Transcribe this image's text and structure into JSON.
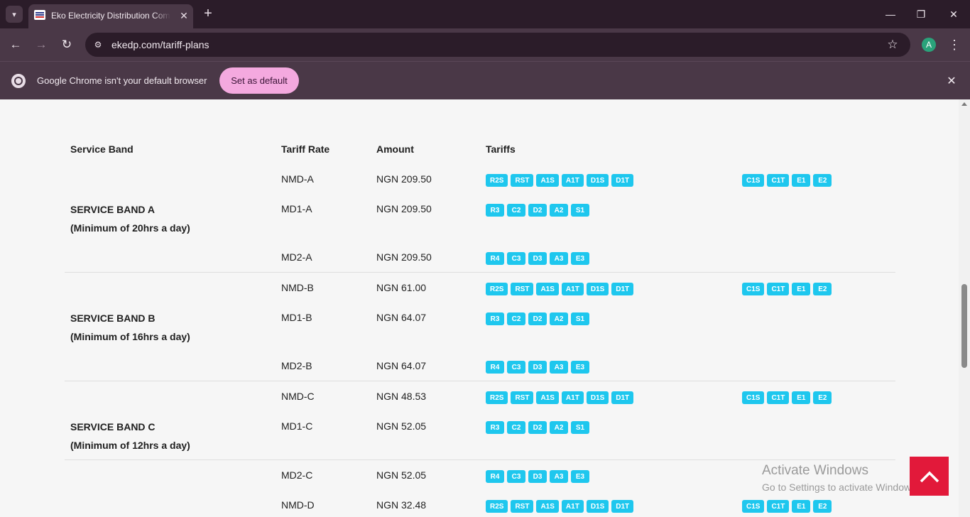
{
  "browser": {
    "tab_title": "Eko Electricity Distribution Company",
    "url": "ekedp.com/tariff-plans",
    "avatar_letter": "A",
    "infobar_text": "Google Chrome isn't your default browser",
    "set_default_label": "Set as default"
  },
  "table": {
    "headers": {
      "service_band": "Service Band",
      "tariff_rate": "Tariff Rate",
      "amount": "Amount",
      "tariffs": "Tariffs"
    },
    "bands": [
      {
        "name": "SERVICE BAND A",
        "subtitle": "(Minimum of 20hrs a day)",
        "rows": [
          {
            "rate": "NMD-A",
            "amount": "NGN 209.50",
            "tariffs": [
              "R2S",
              "RST",
              "A1S",
              "A1T",
              "D1S",
              "D1T"
            ],
            "tariffs_extra": [
              "C1S",
              "C1T",
              "E1",
              "E2"
            ]
          },
          {
            "rate": "MD1-A",
            "amount": "NGN 209.50",
            "tariffs": [
              "R3",
              "C2",
              "D2",
              "A2",
              "S1"
            ],
            "tariffs_extra": []
          },
          {
            "rate": "MD2-A",
            "amount": "NGN 209.50",
            "tariffs": [
              "R4",
              "C3",
              "D3",
              "A3",
              "E3"
            ],
            "tariffs_extra": []
          }
        ]
      },
      {
        "name": "SERVICE BAND B",
        "subtitle": "(Minimum of 16hrs a day)",
        "rows": [
          {
            "rate": "NMD-B",
            "amount": "NGN 61.00",
            "tariffs": [
              "R2S",
              "RST",
              "A1S",
              "A1T",
              "D1S",
              "D1T"
            ],
            "tariffs_extra": [
              "C1S",
              "C1T",
              "E1",
              "E2"
            ]
          },
          {
            "rate": "MD1-B",
            "amount": "NGN 64.07",
            "tariffs": [
              "R3",
              "C2",
              "D2",
              "A2",
              "S1"
            ],
            "tariffs_extra": []
          },
          {
            "rate": "MD2-B",
            "amount": "NGN 64.07",
            "tariffs": [
              "R4",
              "C3",
              "D3",
              "A3",
              "E3"
            ],
            "tariffs_extra": []
          }
        ]
      },
      {
        "name": "SERVICE BAND C",
        "subtitle": "(Minimum of 12hrs a day)",
        "rows": [
          {
            "rate": "NMD-C",
            "amount": "NGN 48.53",
            "tariffs": [
              "R2S",
              "RST",
              "A1S",
              "A1T",
              "D1S",
              "D1T"
            ],
            "tariffs_extra": [
              "C1S",
              "C1T",
              "E1",
              "E2"
            ]
          },
          {
            "rate": "MD1-C",
            "amount": "NGN 52.05",
            "tariffs": [
              "R3",
              "C2",
              "D2",
              "A2",
              "S1"
            ],
            "tariffs_extra": []
          },
          {
            "rate": "MD2-C",
            "amount": "NGN 52.05",
            "tariffs": [
              "R4",
              "C3",
              "D3",
              "A3",
              "E3"
            ],
            "tariffs_extra": []
          }
        ]
      },
      {
        "name": "",
        "subtitle": "",
        "rows": [
          {
            "rate": "NMD-D",
            "amount": "NGN 32.48",
            "tariffs": [
              "R2S",
              "RST",
              "A1S",
              "A1T",
              "D1S",
              "D1T"
            ],
            "tariffs_extra": [
              "C1S",
              "C1T",
              "E1",
              "E2"
            ]
          }
        ]
      }
    ]
  },
  "watermark": {
    "title": "Activate Windows",
    "subtitle": "Go to Settings to activate Windows."
  },
  "colors": {
    "tag": "#1ec7ee",
    "back_to_top": "#e2193a",
    "set_default": "#f4a9df"
  }
}
